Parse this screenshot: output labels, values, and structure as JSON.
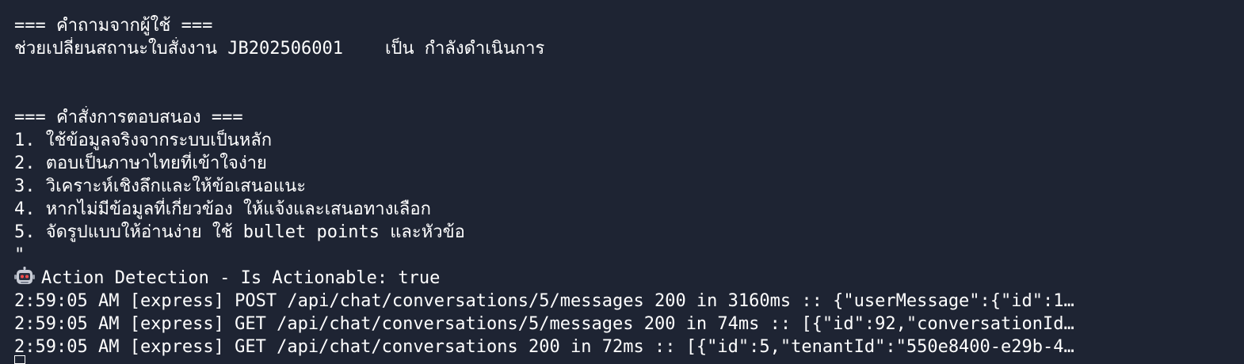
{
  "terminal": {
    "user_question_header": "=== คำถามจากผู้ใช้ ===",
    "user_question": "ช่วยเปลี่ยนสถานะใบสั่งงาน JB202506001    เป็น กำลังดำเนินการ",
    "response_header": "=== คำสั่งการตอบสนอง ===",
    "instructions": [
      "1. ใช้ข้อมูลจริงจากระบบเป็นหลัก",
      "2. ตอบเป็นภาษาไทยที่เข้าใจง่าย",
      "3. วิเคราะห์เชิงลึกและให้ข้อเสนอแนะ",
      "4. หากไม่มีข้อมูลที่เกี่ยวข้อง ให้แจ้งและเสนอทางเลือก",
      "5. จัดรูปแบบให้อ่านง่าย ใช้ bullet points และหัวข้อ"
    ],
    "closing_quote": "\"",
    "action_detection": "Action Detection - Is Actionable: true",
    "action_icon": "robot-icon",
    "logs": [
      "2:59:05 AM [express] POST /api/chat/conversations/5/messages 200 in 3160ms :: {\"userMessage\":{\"id\":1…",
      "2:59:05 AM [express] GET /api/chat/conversations/5/messages 200 in 74ms :: [{\"id\":92,\"conversationId…",
      "2:59:05 AM [express] GET /api/chat/conversations 200 in 72ms :: [{\"id\":5,\"tenantId\":\"550e8400-e29b-4…"
    ]
  },
  "colors": {
    "background": "#1e2433",
    "text": "#ffffff"
  }
}
